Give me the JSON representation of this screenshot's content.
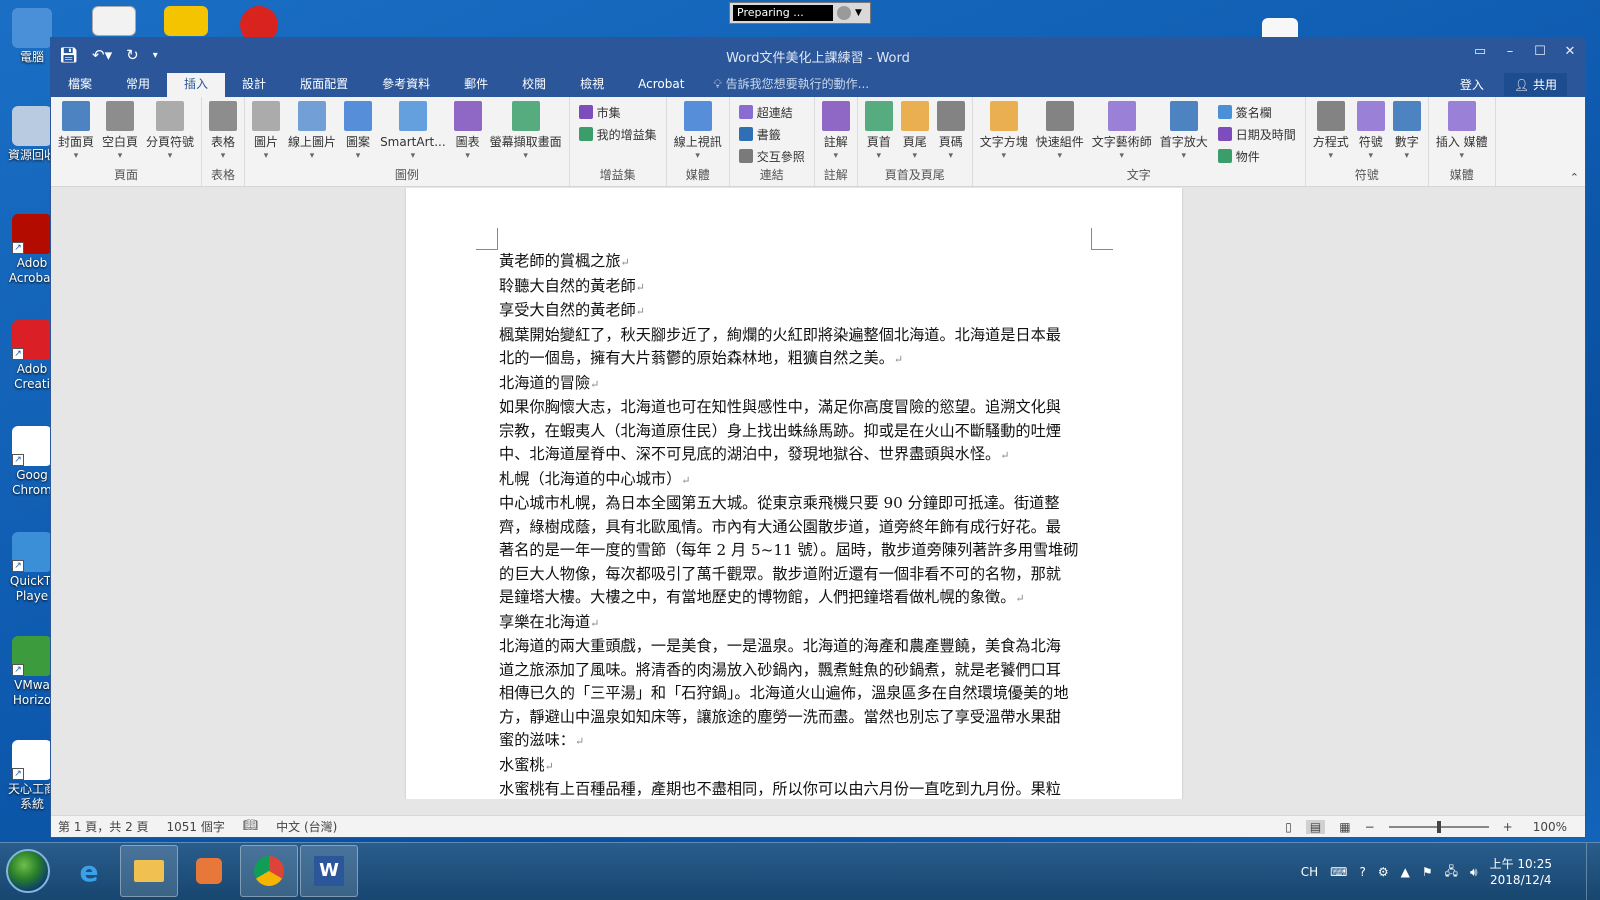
{
  "desktop": {
    "icons": [
      {
        "label": "電腦",
        "color": "#4a90d9"
      },
      {
        "label": "資源回收",
        "color": "#b9cbe0"
      },
      {
        "label": "Adob Acrobat",
        "color": "#b30b00"
      },
      {
        "label": "Adob Creati",
        "color": "#da1f26"
      },
      {
        "label": "Goog Chrom",
        "color": "#ffffff"
      },
      {
        "label": "QuickTi Playe",
        "color": "#3a8fd6"
      },
      {
        "label": "VMwa Horizo",
        "color": "#3c9b3c"
      },
      {
        "label": "天心工商 系統",
        "color": "#ffffff"
      }
    ],
    "preparing_text": "Preparing ..."
  },
  "window": {
    "title": "Word文件美化上課練習 - Word",
    "tabs": [
      "檔案",
      "常用",
      "插入",
      "設計",
      "版面配置",
      "參考資料",
      "郵件",
      "校閱",
      "檢視",
      "Acrobat"
    ],
    "active_tab": "插入",
    "tell_me": "告訴我您想要執行的動作...",
    "sign_in": "登入",
    "share": "共用"
  },
  "ribbon": {
    "groups": [
      {
        "label": "頁面",
        "buttons": [
          "封面頁",
          "空白頁",
          "分頁符號"
        ]
      },
      {
        "label": "表格",
        "buttons": [
          "表格"
        ]
      },
      {
        "label": "圖例",
        "buttons": [
          "圖片",
          "線上圖片",
          "圖案",
          "SmartArt...",
          "圖表",
          "螢幕擷取畫面"
        ]
      },
      {
        "label": "增益集",
        "small": [
          "市集",
          "我的增益集"
        ]
      },
      {
        "label": "媒體",
        "buttons": [
          "線上視訊"
        ]
      },
      {
        "label": "連結",
        "small": [
          "超連結",
          "書籤",
          "交互參照"
        ]
      },
      {
        "label": "註解",
        "buttons": [
          "註解"
        ]
      },
      {
        "label": "頁首及頁尾",
        "buttons": [
          "頁首",
          "頁尾",
          "頁碼"
        ]
      },
      {
        "label": "文字",
        "buttons": [
          "文字方塊",
          "快速組件",
          "文字藝術師",
          "首字放大"
        ],
        "small": [
          "簽名欄",
          "日期及時間",
          "物件"
        ]
      },
      {
        "label": "符號",
        "buttons": [
          "方程式",
          "符號",
          "數字"
        ]
      },
      {
        "label": "媒體",
        "buttons": [
          "插入 媒體"
        ]
      }
    ]
  },
  "document": {
    "lines": [
      "黃老師的賞楓之旅",
      "聆聽大自然的黃老師",
      "享受大自然的黃老師",
      "楓葉開始變紅了，秋天腳步近了，絢爛的火紅即將染遍整個北海道。北海道是日本最",
      "北的一個島，擁有大片蓊鬱的原始森林地，粗獷自然之美。",
      "北海道的冒險",
      "如果你胸懷大志，北海道也可在知性與感性中，滿足你高度冒險的慾望。追溯文化與",
      "宗教，在蝦夷人（北海道原住民）身上找出蛛絲馬跡。抑或是在火山不斷騷動的吐煙",
      "中、北海道屋脊中、深不可見底的湖泊中，發現地獄谷、世界盡頭與水怪。",
      "札幌（北海道的中心城市）",
      "中心城市札幌，為日本全國第五大城。從東京乘飛機只要 90 分鐘即可抵達。街道整",
      "齊，綠樹成蔭，具有北歐風情。市內有大通公園散步道，道旁終年飾有成行好花。最",
      "著名的是一年一度的雪節（每年 2 月 5~11 號）。屆時，散步道旁陳列著許多用雪堆砌",
      "的巨大人物像，每次都吸引了萬千觀眾。散步道附近還有一個非看不可的名物，那就",
      "是鐘塔大樓。大樓之中，有當地歷史的博物館，人們把鐘塔看做札幌的象徵。",
      "享樂在北海道",
      "北海道的兩大重頭戲，一是美食，一是溫泉。北海道的海產和農產豐饒，美食為北海",
      "道之旅添加了風味。將清香的肉湯放入砂鍋內，飄煮鮭魚的砂鍋煮，就是老饕們口耳",
      "相傳已久的「三平湯」和「石狩鍋」。北海道火山遍佈，溫泉區多在自然環境優美的地",
      "方，靜避山中溫泉如知床等，讓旅途的塵勞一洗而盡。當然也別忘了享受溫帶水果甜",
      "蜜的滋味：",
      "水蜜桃",
      "水蜜桃有上百種品種，產期也不盡相同，所以你可以由六月份一直吃到九月份。果粒"
    ],
    "paragraph_ends": [
      0,
      1,
      2,
      4,
      5,
      8,
      9,
      14,
      15,
      20,
      21
    ]
  },
  "status": {
    "page": "第 1 頁，共 2 頁",
    "words": "1051 個字",
    "language": "中文 (台灣)",
    "zoom": "100%",
    "zoom_level": 100
  },
  "taskbar": {
    "ime": "CH",
    "time": "上午 10:25",
    "date": "2018/12/4"
  },
  "colors": {
    "word_blue": "#2b579a",
    "desktop_blue": "#1a6fc4"
  }
}
